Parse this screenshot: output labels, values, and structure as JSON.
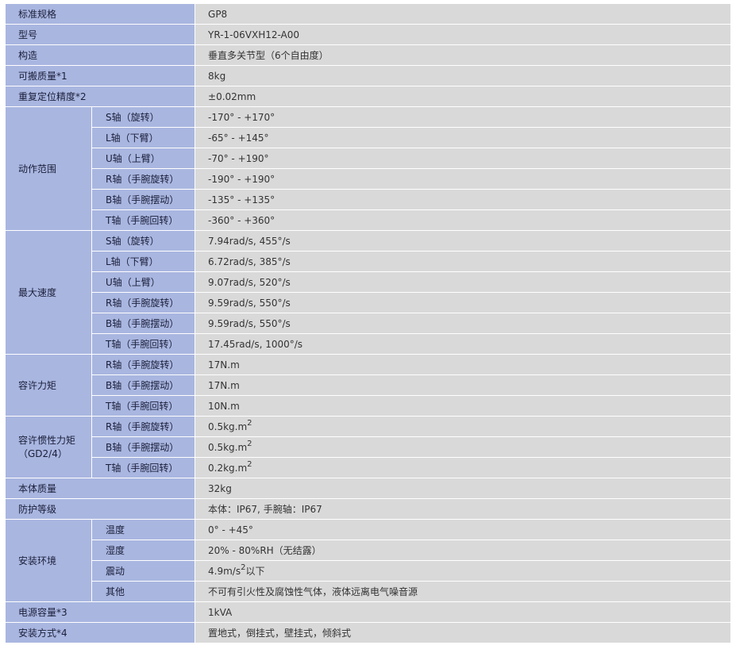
{
  "rows": [
    {
      "label": "标准规格",
      "value": "GP8"
    },
    {
      "label": "型号",
      "value": "YR-1-06VXH12-A00"
    },
    {
      "label": "构造",
      "value": "垂直多关节型（6个自由度）"
    },
    {
      "label": "可搬质量*1",
      "value": "8kg"
    },
    {
      "label": "重复定位精度*2",
      "value": "±0.02mm"
    }
  ],
  "groups": {
    "motion_range": {
      "label": "动作范围",
      "rows": [
        {
          "sub": "S轴（旋转）",
          "value": "-170° - +170°"
        },
        {
          "sub": "L轴（下臂）",
          "value": "-65° - +145°"
        },
        {
          "sub": "U轴（上臂）",
          "value": "-70° - +190°"
        },
        {
          "sub": "R轴（手腕旋转）",
          "value": "-190° - +190°"
        },
        {
          "sub": "B轴（手腕摆动）",
          "value": "-135° - +135°"
        },
        {
          "sub": "T轴（手腕回转）",
          "value": "-360° - +360°"
        }
      ]
    },
    "max_speed": {
      "label": "最大速度",
      "rows": [
        {
          "sub": "S轴（旋转）",
          "value": "7.94rad/s, 455°/s"
        },
        {
          "sub": "L轴（下臂）",
          "value": "6.72rad/s, 385°/s"
        },
        {
          "sub": "U轴（上臂）",
          "value": "9.07rad/s, 520°/s"
        },
        {
          "sub": "R轴（手腕旋转）",
          "value": "9.59rad/s, 550°/s"
        },
        {
          "sub": "B轴（手腕摆动）",
          "value": "9.59rad/s, 550°/s"
        },
        {
          "sub": "T轴（手腕回转）",
          "value": "17.45rad/s, 1000°/s"
        }
      ]
    },
    "allowable_torque": {
      "label": "容许力矩",
      "rows": [
        {
          "sub": "R轴（手腕旋转）",
          "value": "17N.m"
        },
        {
          "sub": "B轴（手腕摆动）",
          "value": "17N.m"
        },
        {
          "sub": "T轴（手腕回转）",
          "value": "10N.m"
        }
      ]
    },
    "inertia": {
      "label_line1": "容许惯性力矩",
      "label_line2": "（GD2/4）",
      "sup": "2",
      "rows": [
        {
          "sub": "R轴（手腕旋转）",
          "value": "0.5kg.m"
        },
        {
          "sub": "B轴（手腕摆动）",
          "value": "0.5kg.m"
        },
        {
          "sub": "T轴（手腕回转）",
          "value": "0.2kg.m"
        }
      ]
    }
  },
  "rows2": [
    {
      "label": "本体质量",
      "value": "32kg"
    },
    {
      "label": "防护等级",
      "value": "本体：IP67, 手腕轴：IP67"
    }
  ],
  "environment": {
    "label": "安装环境",
    "rows": [
      {
        "sub": "温度",
        "value": "0° - +45°"
      },
      {
        "sub": "湿度",
        "value": "20% - 80%RH（无结露）"
      },
      {
        "sub": "震动",
        "value_pre": "4.9m/s",
        "sup": "2",
        "value_post": "以下"
      },
      {
        "sub": "其他",
        "value": "不可有引火性及腐蚀性气体，液体远离电气噪音源"
      }
    ]
  },
  "rows3": [
    {
      "label": "电源容量*3",
      "value": "1kVA"
    },
    {
      "label": "安装方式*4",
      "value": "置地式，倒挂式，壁挂式，倾斜式"
    }
  ]
}
